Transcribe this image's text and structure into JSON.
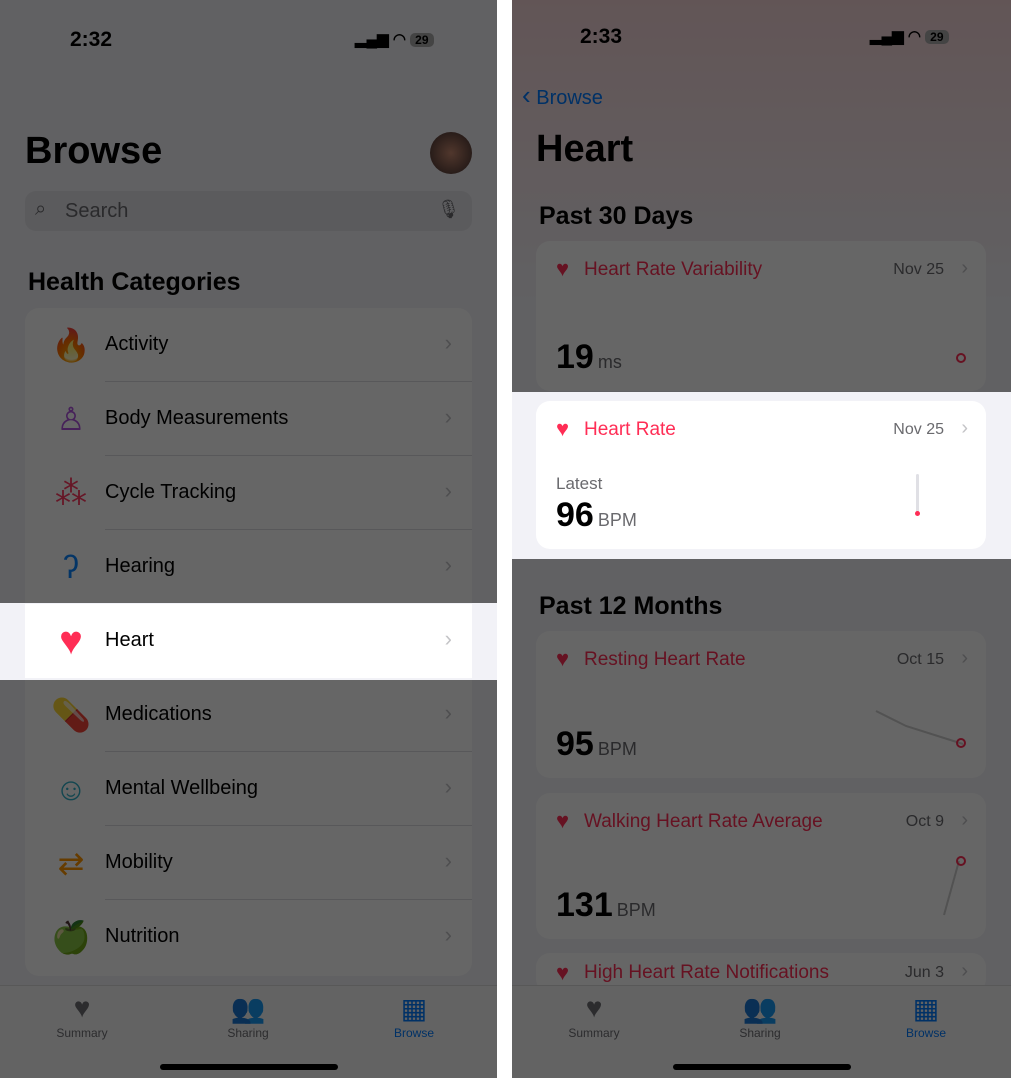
{
  "left": {
    "status": {
      "time": "2:32",
      "battery": "29"
    },
    "title": "Browse",
    "search": {
      "placeholder": "Search"
    },
    "section": "Health Categories",
    "categories": [
      {
        "label": "Activity",
        "icon": "flame-icon",
        "color": "#ff453a"
      },
      {
        "label": "Body Measurements",
        "icon": "figure-icon",
        "color": "#af52de"
      },
      {
        "label": "Cycle Tracking",
        "icon": "cycle-icon",
        "color": "#ff375f"
      },
      {
        "label": "Hearing",
        "icon": "ear-icon",
        "color": "#0a84ff"
      },
      {
        "label": "Heart",
        "icon": "heart-icon",
        "color": "#ff2d55"
      },
      {
        "label": "Medications",
        "icon": "pills-icon",
        "color": "#32ade6"
      },
      {
        "label": "Mental Wellbeing",
        "icon": "head-icon",
        "color": "#30b0c7"
      },
      {
        "label": "Mobility",
        "icon": "arrows-icon",
        "color": "#ff9500"
      },
      {
        "label": "Nutrition",
        "icon": "apple-icon",
        "color": "#34c759"
      }
    ],
    "tabs": [
      {
        "label": "Summary"
      },
      {
        "label": "Sharing"
      },
      {
        "label": "Browse",
        "active": true
      }
    ]
  },
  "right": {
    "status": {
      "time": "2:33",
      "battery": "29"
    },
    "back": "Browse",
    "title": "Heart",
    "sections": [
      "Past 30 Days",
      "Past 12 Months"
    ],
    "cards": [
      {
        "title": "Heart Rate Variability",
        "date": "Nov 25",
        "value": "19",
        "unit": "ms"
      },
      {
        "title": "Heart Rate",
        "date": "Nov 25",
        "label": "Latest",
        "value": "96",
        "unit": "BPM"
      },
      {
        "title": "Resting Heart Rate",
        "date": "Oct 15",
        "value": "95",
        "unit": "BPM"
      },
      {
        "title": "Walking Heart Rate Average",
        "date": "Oct 9",
        "value": "131",
        "unit": "BPM"
      },
      {
        "title": "High Heart Rate Notifications",
        "date": "Jun 3"
      }
    ],
    "tabs": [
      {
        "label": "Summary"
      },
      {
        "label": "Sharing"
      },
      {
        "label": "Browse",
        "active": true
      }
    ]
  },
  "accent": "#007aff"
}
